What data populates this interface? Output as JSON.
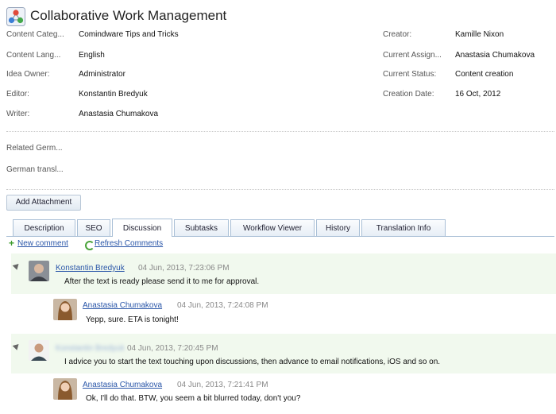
{
  "header": {
    "title": "Collaborative Work Management"
  },
  "fields_left": [
    {
      "label": "Content Categ...",
      "value": "Comindware Tips and Tricks"
    },
    {
      "label": "Content Lang...",
      "value": "English"
    },
    {
      "label": "Idea Owner:",
      "value": "Administrator"
    },
    {
      "label": "Editor:",
      "value": "Konstantin Bredyuk"
    },
    {
      "label": "Writer:",
      "value": "Anastasia Chumakova"
    }
  ],
  "fields_right": [
    {
      "label": "Creator:",
      "value": "Kamille Nixon"
    },
    {
      "label": "Current Assign...",
      "value": "Anastasia Chumakova"
    },
    {
      "label": "Current Status:",
      "value": "Content creation"
    },
    {
      "label": "Creation Date:",
      "value": "16 Oct, 2012"
    }
  ],
  "related": {
    "label": "Related Germ...",
    "german_label": "German transl..."
  },
  "attachment": {
    "button_label": "Add Attachment"
  },
  "tabs": [
    "Description",
    "SEO",
    "Discussion",
    "Subtasks",
    "Workflow Viewer",
    "History",
    "Translation Info"
  ],
  "actions": {
    "new_comment": "New comment",
    "refresh": "Refresh Comments"
  },
  "comments": [
    {
      "author": "Konstantin Bredyuk",
      "time": "04 Jun, 2013, 7:23:06 PM",
      "text": "After the text is ready please send it to me for approval."
    },
    {
      "author": "Anastasia Chumakova",
      "time": "04 Jun, 2013, 7:24:08 PM",
      "text": "Yepp, sure. ETA is tonight!"
    },
    {
      "author": "Konstantin Bredyuk",
      "time": "04 Jun, 2013, 7:20:45 PM",
      "text": "I advice you to start the text touching upon discussions, then advance to email notifications, iOS and so on."
    },
    {
      "author": "Anastasia Chumakova",
      "time": "04 Jun, 2013, 7:21:41 PM",
      "text": "Ok, I'll do that. BTW, you seem a bit blurred today, don't you?"
    }
  ]
}
